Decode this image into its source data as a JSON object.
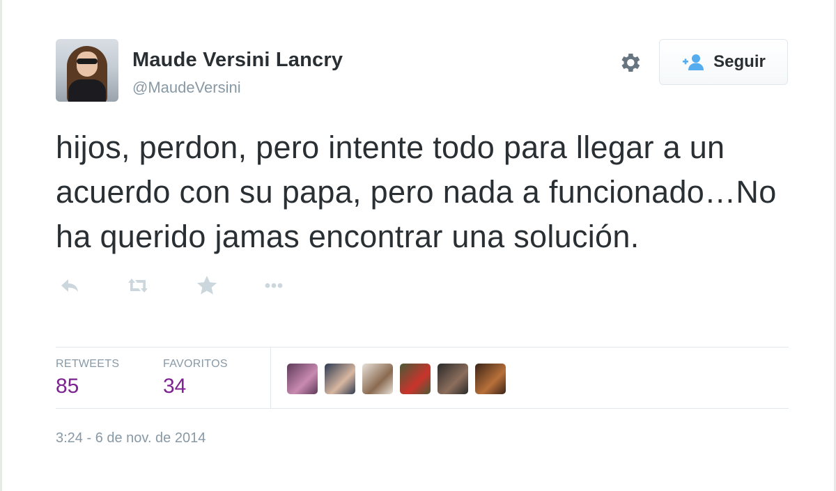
{
  "user": {
    "name": "Maude Versini Lancry",
    "handle": "@MaudeVersini"
  },
  "follow_button": {
    "label": "Seguir",
    "icon": "add-user-icon"
  },
  "settings_icon": "gear-icon",
  "tweet": {
    "text": "hijos, perdon, pero intente todo para llegar a un acuerdo con su papa, pero nada a funcionado…No ha querido jamas encontrar una solución."
  },
  "actions": [
    {
      "name": "reply-icon"
    },
    {
      "name": "retweet-icon"
    },
    {
      "name": "favorite-star-icon"
    },
    {
      "name": "more-dots-icon"
    }
  ],
  "stats": {
    "retweets_label": "RETWEETS",
    "retweets_value": "85",
    "favorites_label": "FAVORITOS",
    "favorites_value": "34",
    "value_color": "#7d2391"
  },
  "favoriters": [
    {
      "colors": [
        "#5d3a5a",
        "#c98ab0"
      ]
    },
    {
      "colors": [
        "#2e3a52",
        "#d8b7a0"
      ]
    },
    {
      "colors": [
        "#e8e2da",
        "#8a6a50"
      ]
    },
    {
      "colors": [
        "#4a5a38",
        "#c9342c"
      ]
    },
    {
      "colors": [
        "#2a2a2a",
        "#8c6e5c"
      ]
    },
    {
      "colors": [
        "#3a2418",
        "#b8703a"
      ]
    }
  ],
  "timestamp": "3:24 - 6 de nov. de 2014",
  "colors": {
    "text": "#292f33",
    "muted": "#8899a6",
    "border": "#e1e8ed",
    "follow_icon": "#55acee"
  }
}
